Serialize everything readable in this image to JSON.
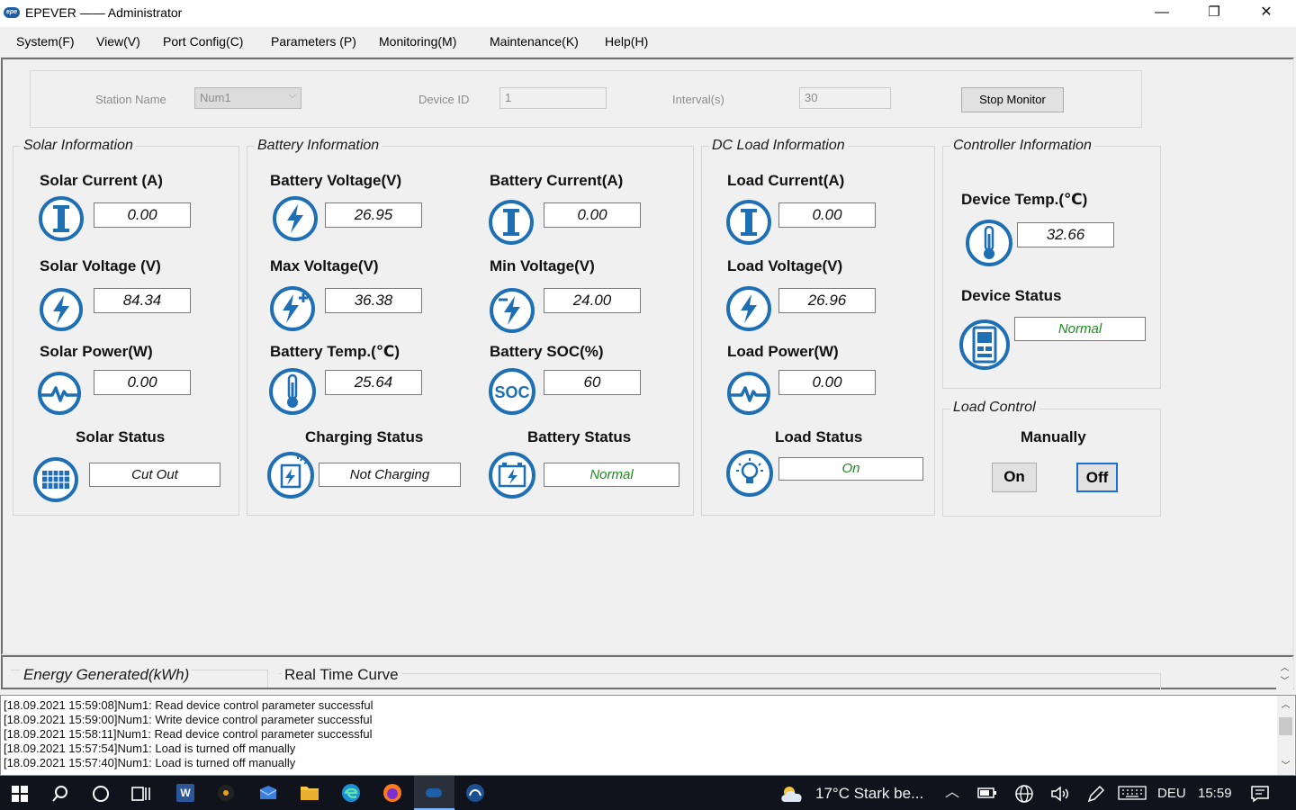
{
  "window": {
    "title": "EPEVER —— Administrator",
    "logo_text": "epe"
  },
  "window_controls": {
    "minimize": "—",
    "restore": "❐",
    "close": "✕"
  },
  "menu": [
    "System(F)",
    "View(V)",
    "Port Config(C)",
    "Parameters (P)",
    "Monitoring(M)",
    "Maintenance(K)",
    "Help(H)"
  ],
  "toolbar": {
    "station_label": "Station Name",
    "station_value": "Num1",
    "device_label": "Device ID",
    "device_value": "1",
    "interval_label": "Interval(s)",
    "interval_value": "30",
    "stop_button": "Stop Monitor"
  },
  "solar": {
    "title": "Solar Information",
    "current_label": "Solar Current (A)",
    "current": "0.00",
    "voltage_label": "Solar Voltage (V)",
    "voltage": "84.34",
    "power_label": "Solar Power(W)",
    "power": "0.00",
    "status_label": "Solar Status",
    "status": "Cut Out"
  },
  "battery": {
    "title": "Battery Information",
    "voltage_label": "Battery Voltage(V)",
    "voltage": "26.95",
    "current_label": "Battery Current(A)",
    "current": "0.00",
    "max_label": "Max Voltage(V)",
    "max": "36.38",
    "min_label": "Min Voltage(V)",
    "min": "24.00",
    "temp_label": "Battery Temp.(℃)",
    "temp": "25.64",
    "soc_label": "Battery SOC(%)",
    "soc": "60",
    "soc_icon_text": "SOC",
    "charging_label": "Charging Status",
    "charging": "Not Charging",
    "status_label": "Battery Status",
    "status": "Normal"
  },
  "load": {
    "title": "DC Load Information",
    "current_label": "Load Current(A)",
    "current": "0.00",
    "voltage_label": "Load Voltage(V)",
    "voltage": "26.96",
    "power_label": "Load Power(W)",
    "power": "0.00",
    "status_label": "Load Status",
    "status": "On"
  },
  "controller": {
    "title": "Controller Information",
    "temp_label": "Device Temp.(℃)",
    "temp": "32.66",
    "status_label": "Device Status",
    "status": "Normal"
  },
  "load_control": {
    "title": "Load Control",
    "mode": "Manually",
    "on": "On",
    "off": "Off"
  },
  "tabs": {
    "energy": "Energy Generated(kWh)",
    "curve": "Real Time Curve"
  },
  "log": [
    "[18.09.2021 15:59:08]Num1: Read device control parameter successful",
    "[18.09.2021 15:59:00]Num1: Write device control parameter successful",
    "[18.09.2021 15:58:11]Num1: Read device control parameter successful",
    "[18.09.2021 15:57:54]Num1: Load is turned off manually",
    "[18.09.2021 15:57:40]Num1: Load is turned off manually"
  ],
  "taskbar": {
    "weather": "17°C  Stark be...",
    "language": "DEU",
    "time": "15:59"
  },
  "colors": {
    "accent": "#1f6fb5",
    "green": "#1e8c1e",
    "taskbar": "#10131c"
  }
}
